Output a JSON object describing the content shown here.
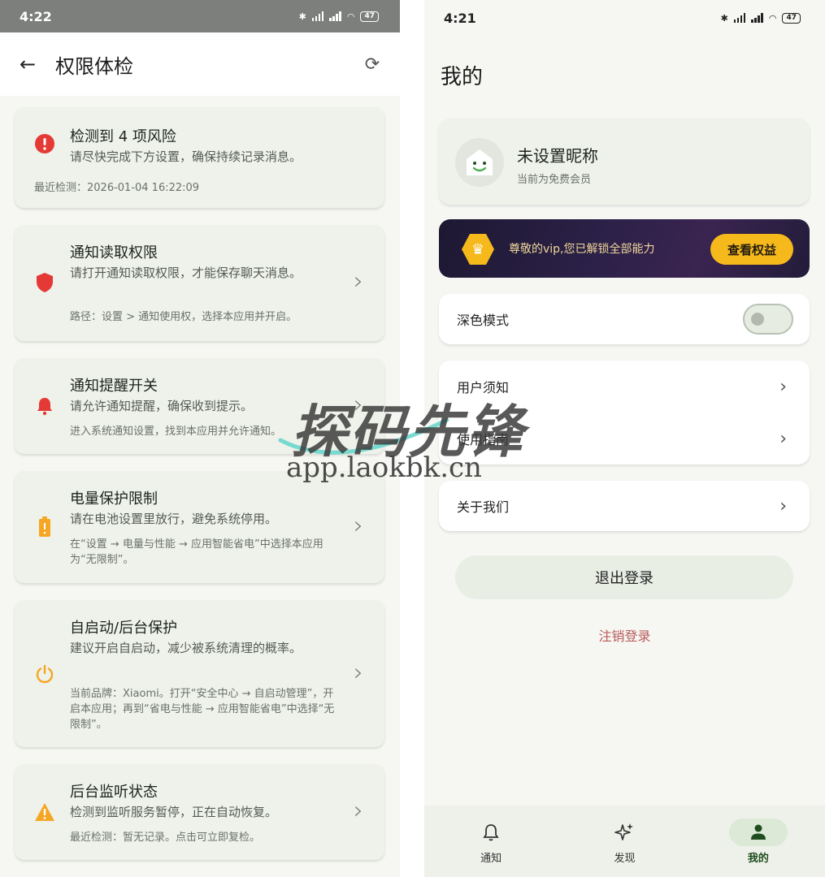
{
  "left": {
    "status": {
      "time": "4:22",
      "battery": "47"
    },
    "title": "权限体检",
    "risk": {
      "title": "检测到 4 项风险",
      "desc": "请尽快完成下方设置，确保持续记录消息。",
      "time": "最近检测：2026-01-04 16:22:09"
    },
    "cards": [
      {
        "title": "通知读取权限",
        "desc": "请打开通知读取权限，才能保存聊天消息。",
        "hint": "路径：设置 > 通知使用权，选择本应用并开启。"
      },
      {
        "title": "通知提醒开关",
        "desc": "请允许通知提醒，确保收到提示。",
        "hint": "进入系统通知设置，找到本应用并允许通知。"
      },
      {
        "title": "电量保护限制",
        "desc": "请在电池设置里放行，避免系统停用。",
        "hint": "在“设置 → 电量与性能 → 应用智能省电”中选择本应用为“无限制”。"
      },
      {
        "title": "自启动/后台保护",
        "desc": "建议开启自启动，减少被系统清理的概率。",
        "hint": "当前品牌：Xiaomi。打开“安全中心 → 自启动管理”，开启本应用；再到“省电与性能 → 应用智能省电”中选择“无限制”。"
      },
      {
        "title": "后台监听状态",
        "desc": "检测到监听服务暂停，正在自动恢复。",
        "hint": "最近检测：暂无记录。点击可立即复检。"
      }
    ]
  },
  "right": {
    "status": {
      "time": "4:21",
      "battery": "47"
    },
    "title": "我的",
    "profile": {
      "nickname": "未设置昵称",
      "member": "当前为免费会员"
    },
    "vip": {
      "text": "尊敬的vip,您已解锁全部能力",
      "button": "查看权益"
    },
    "settings": {
      "dark_mode": "深色模式",
      "user_notice": "用户须知",
      "guide": "使用指南",
      "about": "关于我们"
    },
    "logout": "退出登录",
    "cancel": "注销登录",
    "nav": [
      {
        "label": "通知",
        "icon": "bell-icon"
      },
      {
        "label": "发现",
        "icon": "sparkle-icon"
      },
      {
        "label": "我的",
        "icon": "person-icon"
      }
    ]
  },
  "watermark": {
    "brand": "探码先锋",
    "url": "app.laokbk.cn"
  },
  "colors": {
    "accent_green": "#1f4d1f",
    "danger": "#e53935",
    "warning": "#f5a623",
    "vip_gold": "#f6b91c"
  }
}
